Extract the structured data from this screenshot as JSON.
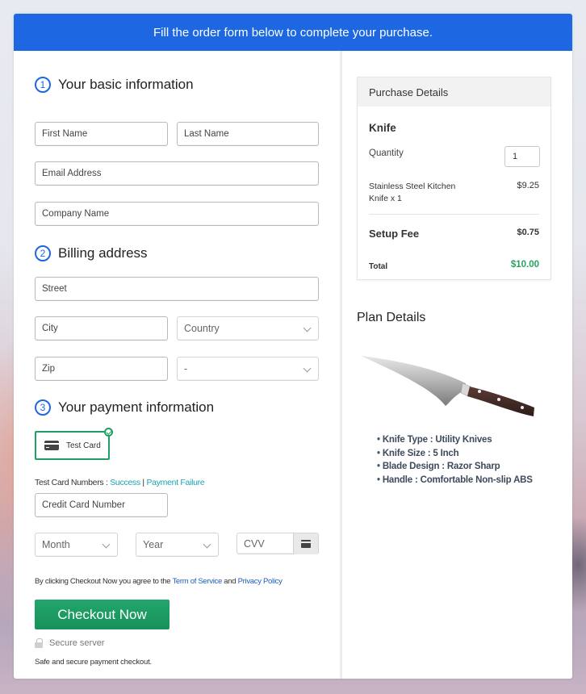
{
  "banner": {
    "text": "Fill the order form below to complete your purchase."
  },
  "sections": {
    "basic": {
      "number": "1",
      "title": "Your basic information"
    },
    "billing": {
      "number": "2",
      "title": "Billing address"
    },
    "payment": {
      "number": "3",
      "title": "Your payment information"
    }
  },
  "fields": {
    "first_name": {
      "placeholder": "First Name",
      "value": ""
    },
    "last_name": {
      "placeholder": "Last Name",
      "value": ""
    },
    "email": {
      "placeholder": "Email Address",
      "value": ""
    },
    "company": {
      "placeholder": "Company Name",
      "value": ""
    },
    "street": {
      "placeholder": "Street",
      "value": ""
    },
    "city": {
      "placeholder": "City",
      "value": ""
    },
    "country": {
      "selected": "Country"
    },
    "zip": {
      "placeholder": "Zip",
      "value": ""
    },
    "state": {
      "selected": "-"
    },
    "card_number": {
      "placeholder": "Credit Card Number",
      "value": ""
    },
    "month": {
      "selected": "Month"
    },
    "year": {
      "selected": "Year"
    },
    "cvv": {
      "placeholder": "CVV",
      "value": ""
    }
  },
  "payment": {
    "method_label": "Test Card",
    "method_selected": true,
    "test_numbers_label": "Test Card Numbers : ",
    "success_link": "Success",
    "separator": " | ",
    "failure_link": "Payment Failure"
  },
  "agreement": {
    "prefix": "By clicking Checkout Now you agree to the ",
    "tos_link": "Term of Service",
    "and": " and ",
    "privacy_link": "Privacy Policy"
  },
  "checkout": {
    "label": "Checkout Now"
  },
  "secure": {
    "label": "Secure server",
    "note": "Safe and secure payment checkout."
  },
  "purchase": {
    "heading": "Purchase Details",
    "product": "Knife",
    "quantity_label": "Quantity",
    "quantity": "1",
    "item_line": "Stainless Steel Kitchen Knife x 1",
    "item_price": "$9.25",
    "setup_label": "Setup Fee",
    "setup_price": "$0.75",
    "total_label": "Total",
    "total_price": "$10.00"
  },
  "plan": {
    "heading": "Plan Details",
    "features": [
      "Knife Type : Utility Knives",
      "Knife Size : 5 Inch",
      "Blade Design : Razor Sharp",
      "Handle : Comfortable Non-slip ABS"
    ]
  },
  "colors": {
    "brand_blue": "#1d67e2",
    "success_green": "#20a060",
    "total_green": "#2aa25b",
    "link_teal": "#1aa3b0"
  }
}
